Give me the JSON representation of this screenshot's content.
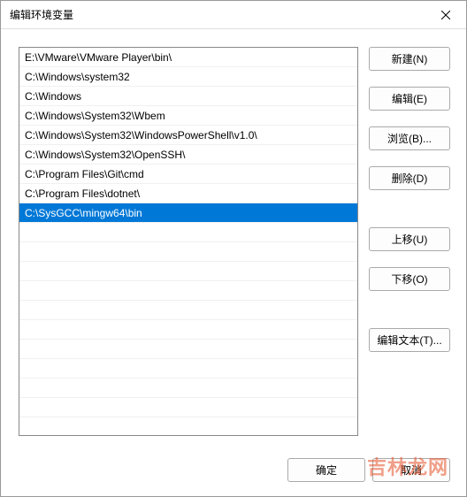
{
  "dialog": {
    "title": "编辑环境变量"
  },
  "paths": [
    "E:\\VMware\\VMware Player\\bin\\",
    "C:\\Windows\\system32",
    "C:\\Windows",
    "C:\\Windows\\System32\\Wbem",
    "C:\\Windows\\System32\\WindowsPowerShell\\v1.0\\",
    "C:\\Windows\\System32\\OpenSSH\\",
    "C:\\Program Files\\Git\\cmd",
    "C:\\Program Files\\dotnet\\",
    "C:\\SysGCC\\mingw64\\bin"
  ],
  "selectedIndex": 8,
  "buttons": {
    "new": "新建(N)",
    "edit": "编辑(E)",
    "browse": "浏览(B)...",
    "delete": "删除(D)",
    "moveUp": "上移(U)",
    "moveDown": "下移(O)",
    "editText": "编辑文本(T)...",
    "ok": "确定",
    "cancel": "取消"
  },
  "watermark": "吉林龙网"
}
